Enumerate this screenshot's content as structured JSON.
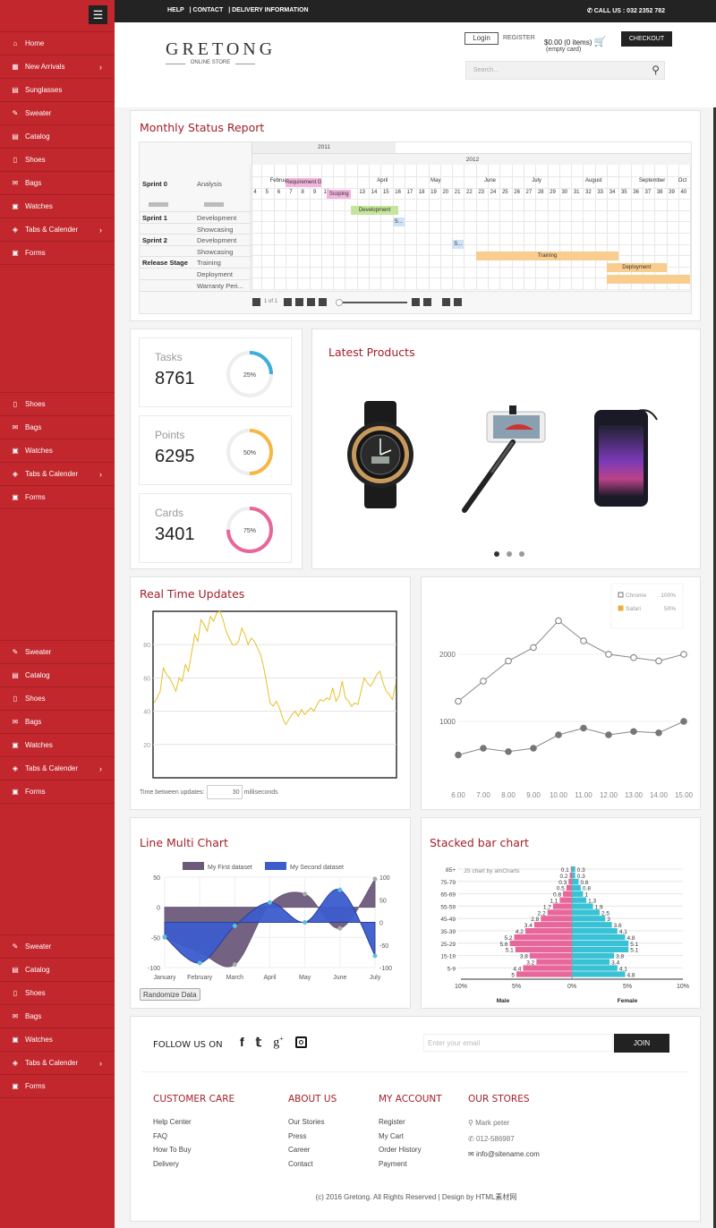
{
  "sidebar": {
    "menu_icon": "hamburger-icon",
    "groups": [
      [
        {
          "label": "Home",
          "icon": "home"
        },
        {
          "label": "New Arrivals",
          "icon": "grid",
          "chev": true
        },
        {
          "label": "Sunglasses",
          "icon": "file"
        },
        {
          "label": "Sweater",
          "icon": "pencil"
        },
        {
          "label": "Catalog",
          "icon": "file"
        },
        {
          "label": "Shoes",
          "icon": "tablet"
        },
        {
          "label": "Bags",
          "icon": "envelope"
        },
        {
          "label": "Watches",
          "icon": "image"
        },
        {
          "label": "Tabs & Calender",
          "icon": "layers",
          "chev": true
        },
        {
          "label": "Forms",
          "icon": "image"
        }
      ],
      [
        {
          "label": "Shoes",
          "icon": "tablet"
        },
        {
          "label": "Bags",
          "icon": "envelope"
        },
        {
          "label": "Watches",
          "icon": "image"
        },
        {
          "label": "Tabs & Calender",
          "icon": "layers",
          "chev": true
        },
        {
          "label": "Forms",
          "icon": "image"
        }
      ],
      [
        {
          "label": "Sweater",
          "icon": "pencil"
        },
        {
          "label": "Catalog",
          "icon": "file"
        },
        {
          "label": "Shoes",
          "icon": "tablet"
        },
        {
          "label": "Bags",
          "icon": "envelope"
        },
        {
          "label": "Watches",
          "icon": "image"
        },
        {
          "label": "Tabs & Calender",
          "icon": "layers",
          "chev": true
        },
        {
          "label": "Forms",
          "icon": "image"
        }
      ],
      [
        {
          "label": "Sweater",
          "icon": "pencil"
        },
        {
          "label": "Catalog",
          "icon": "file"
        },
        {
          "label": "Shoes",
          "icon": "tablet"
        },
        {
          "label": "Bags",
          "icon": "envelope"
        },
        {
          "label": "Watches",
          "icon": "image"
        },
        {
          "label": "Tabs & Calender",
          "icon": "layers",
          "chev": true
        },
        {
          "label": "Forms",
          "icon": "image"
        }
      ]
    ]
  },
  "topbar": {
    "links": [
      "HELP",
      "| CONTACT",
      "| DELIVERY INFORMATION"
    ],
    "call": "CALL US : 032 2352 782"
  },
  "header": {
    "logo": "GRETONG",
    "logo_sub": "ONLINE STORE",
    "login": "Login",
    "register": "REGISTER",
    "cart": "$0.00 (0 items)",
    "cart_sub": "(empty card)",
    "checkout": "CHECKOUT",
    "search_placeholder": "Search..."
  },
  "gantt": {
    "title": "Monthly Status Report",
    "years": [
      "2011",
      "2012"
    ],
    "months": [
      {
        "label": "Februa",
        "week": 6
      },
      {
        "label": "April",
        "week": 15
      },
      {
        "label": "May",
        "week": 19.5
      },
      {
        "label": "June",
        "week": 24
      },
      {
        "label": "July",
        "week": 28
      },
      {
        "label": "August",
        "week": 32.5
      },
      {
        "label": "September",
        "week": 37
      },
      {
        "label": "Oct",
        "week": 40.3
      }
    ],
    "weeks": [
      4,
      5,
      6,
      7,
      8,
      9,
      10,
      13,
      14,
      15,
      16,
      17,
      18,
      19,
      20,
      21,
      22,
      23,
      24,
      25,
      26,
      27,
      28,
      29,
      30,
      31,
      32,
      33,
      34,
      35,
      36,
      37,
      38,
      39,
      40
    ],
    "rows": [
      {
        "group": "Sprint 1",
        "task": "Development"
      },
      {
        "group": "",
        "task": "Showcasing"
      },
      {
        "group": "Sprint 2",
        "task": "Development"
      },
      {
        "group": "",
        "task": "Showcasing"
      },
      {
        "group": "Release Stage",
        "task": "Training"
      },
      {
        "group": "",
        "task": "Deployment"
      },
      {
        "group": "",
        "task": "Warranty Peri..."
      }
    ],
    "header_row": {
      "group": "Sprint 0",
      "task": "Analysis"
    },
    "bars": [
      {
        "label": "Requirement Gather...",
        "start": 7,
        "end": 10,
        "row": -2,
        "color": "#f3b4dd"
      },
      {
        "label": "Scoping",
        "start": 10.5,
        "end": 12.5,
        "row": -1,
        "color": "#f3b4dd"
      },
      {
        "label": "Development",
        "start": 12.5,
        "end": 16.5,
        "row": 0,
        "color": "#c5e59b"
      },
      {
        "label": "S...",
        "start": 16,
        "end": 17,
        "row": 1,
        "color": "#cfe2f7"
      },
      {
        "label": "S...",
        "start": 21,
        "end": 22,
        "row": 3,
        "color": "#cfe2f7"
      },
      {
        "label": "Training",
        "start": 23,
        "end": 35,
        "row": 4,
        "color": "#f9cd8d"
      },
      {
        "label": "Deployment",
        "start": 34,
        "end": 39,
        "row": 5,
        "color": "#f9cd8d"
      },
      {
        "label": "",
        "start": 34,
        "end": 41,
        "row": 6,
        "color": "#f9cd8d"
      }
    ],
    "pager": "1 of 1"
  },
  "stats": [
    {
      "label": "Tasks",
      "value": "8761",
      "percent": 25,
      "pct_label": "25%",
      "color": "#3bafda"
    },
    {
      "label": "Points",
      "value": "6295",
      "percent": 50,
      "pct_label": "50%",
      "color": "#f6b844"
    },
    {
      "label": "Cards",
      "value": "3401",
      "percent": 75,
      "pct_label": "75%",
      "color": "#e8679b"
    }
  ],
  "products": {
    "title": "Latest Products",
    "items": [
      "watch",
      "selfie-stick",
      "speaker"
    ],
    "active_dot": 0,
    "dots": 3
  },
  "realtime": {
    "title": "Real Time Updates",
    "yticks": [
      20,
      40,
      60,
      80
    ],
    "ylim": [
      0,
      100
    ],
    "values": [
      45,
      48,
      52,
      66,
      62,
      60,
      56,
      52,
      60,
      58,
      68,
      64,
      75,
      86,
      82,
      95,
      92,
      88,
      97,
      94,
      99,
      100,
      95,
      88,
      84,
      80,
      80,
      82,
      90,
      86,
      80,
      84,
      82,
      78,
      74,
      66,
      56,
      45,
      43,
      46,
      42,
      36,
      32,
      35,
      38,
      40,
      37,
      41,
      38,
      40,
      42,
      40,
      44,
      47,
      46,
      48,
      47,
      54,
      46,
      49,
      58,
      48,
      46,
      43,
      45,
      44,
      52,
      60,
      57,
      55,
      58,
      62,
      64,
      57,
      52,
      50,
      47,
      56
    ],
    "update_label": "Time between updates:",
    "update_value": "30",
    "update_unit": "milliseconds"
  },
  "chart_data": [
    {
      "type": "line",
      "x": [
        "6.00",
        "7.00",
        "8.00",
        "9.00",
        "10.00",
        "11.00",
        "12.00",
        "13.00",
        "14.00",
        "15.00"
      ],
      "series": [
        {
          "name": "Chrome",
          "values": [
            1300,
            1600,
            1900,
            2100,
            2500,
            2200,
            2000,
            1950,
            1900,
            2000
          ]
        },
        {
          "name": "Safari",
          "values": [
            500,
            600,
            550,
            600,
            800,
            900,
            800,
            850,
            830,
            1000
          ]
        }
      ],
      "legend": [
        {
          "name": "Chrome",
          "value": "100%",
          "color": "#777777"
        },
        {
          "name": "Safari",
          "value": "50%",
          "color": "#e8b13a"
        }
      ],
      "yticks": [
        1000,
        2000
      ],
      "ylim": [
        0,
        2800
      ],
      "legend_position": "top-right"
    },
    {
      "type": "area",
      "title": "Line Multi Chart",
      "categories": [
        "January",
        "February",
        "March",
        "April",
        "May",
        "June",
        "July"
      ],
      "series": [
        {
          "name": "My First dataset",
          "values": [
            -50,
            -75,
            -95,
            5,
            22,
            -35,
            47
          ],
          "color": "#6b5a7a",
          "axis": "left"
        },
        {
          "name": "My Second dataset",
          "values": [
            -32,
            -90,
            -8,
            44,
            0,
            72,
            -74
          ],
          "color": "#3c5ccc",
          "axis": "right"
        }
      ],
      "left_ticks": [
        50,
        0,
        -50,
        -100
      ],
      "right_ticks": [
        100,
        50,
        0,
        -50,
        -100
      ],
      "left_lim": [
        -100,
        50
      ],
      "right_lim": [
        -100,
        100
      ],
      "button": "Randomize Data"
    },
    {
      "type": "bar",
      "title": "Stacked bar chart",
      "orientation": "horizontal",
      "credit": "JS chart by amCharts",
      "categories": [
        "85+",
        "80-84",
        "75-79",
        "70-74",
        "65-69",
        "60-64",
        "55-59",
        "50-54",
        "45-49",
        "40-44",
        "35-39",
        "30-34",
        "25-29",
        "20-24",
        "15-19",
        "10-14",
        "5-9",
        "0-4"
      ],
      "series": [
        {
          "name": "Male",
          "values": [
            0.1,
            0.2,
            0.3,
            0.5,
            0.8,
            1.1,
            1.7,
            2.2,
            2.8,
            3.4,
            4.2,
            5.2,
            5.6,
            5.1,
            3.8,
            3.2,
            4.4,
            5
          ],
          "color": "#e8679b"
        },
        {
          "name": "Female",
          "values": [
            0.3,
            0.3,
            0.6,
            0.8,
            1,
            1.3,
            1.9,
            2.5,
            3,
            3.6,
            4.1,
            4.8,
            5.1,
            5.1,
            3.8,
            3.4,
            4.1,
            4.8
          ],
          "color": "#39c1d6"
        }
      ],
      "xticks": [
        "10%",
        "5%",
        "0%",
        "5%",
        "10%"
      ],
      "xlim": [
        -10,
        10
      ],
      "xlabels": [
        "Male",
        "Female"
      ]
    }
  ],
  "footer": {
    "follow": "FOLLOW US ON",
    "social": [
      "facebook",
      "twitter",
      "google-plus",
      "instagram"
    ],
    "email_placeholder": "Enter your email",
    "join": "JOIN",
    "cols": [
      {
        "title": "CUSTOMER CARE",
        "links": [
          "Help Center",
          "FAQ",
          "How To Buy",
          "Delivery"
        ]
      },
      {
        "title": "ABOUT US",
        "links": [
          "Our Stories",
          "Press",
          "Career",
          "Contact"
        ]
      },
      {
        "title": "MY ACCOUNT",
        "links": [
          "Register",
          "My Cart",
          "Order History",
          "Payment"
        ]
      }
    ],
    "stores": {
      "title": "OUR STORES",
      "name": "Mark peter",
      "phone": "012-586987",
      "email": "info@sitename.com"
    },
    "copyright": "(c) 2016 Gretong. All Rights Reserved | Design by HTML素材网"
  }
}
